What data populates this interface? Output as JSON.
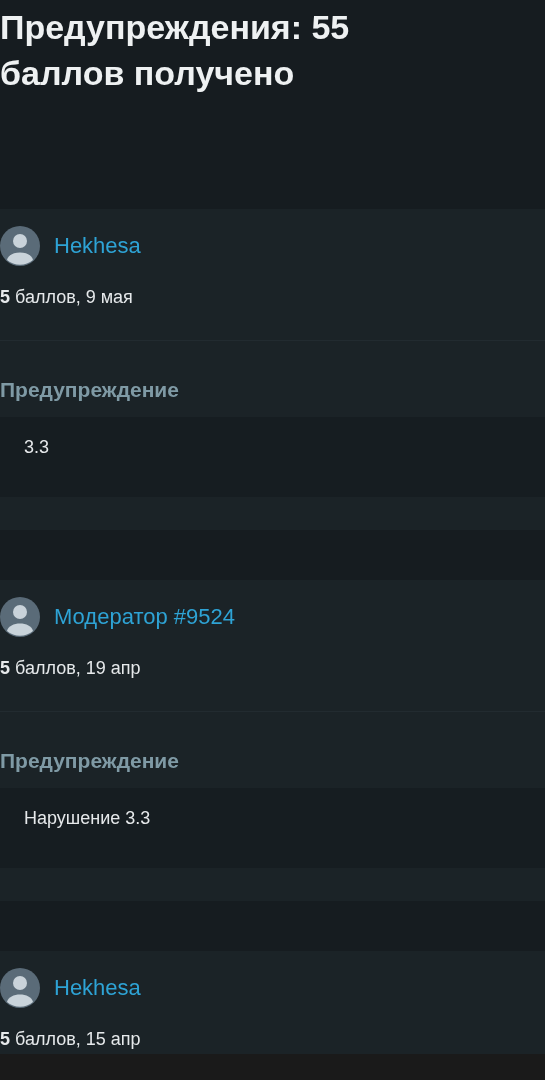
{
  "title": "Предупреждения: 55 баллов получено",
  "warnings": [
    {
      "author": "Hekhesa",
      "points": "**5** баллов, 9 мая",
      "label": "Предупреждение",
      "reason": "3.3"
    },
    {
      "author": "Модератор #9524",
      "points": "**5** баллов, 19 апр",
      "label": "Предупреждение",
      "reason": "Нарушение 3.3"
    },
    {
      "author": "Hekhesa",
      "points": "**5** баллов, 15 апр"
    }
  ]
}
